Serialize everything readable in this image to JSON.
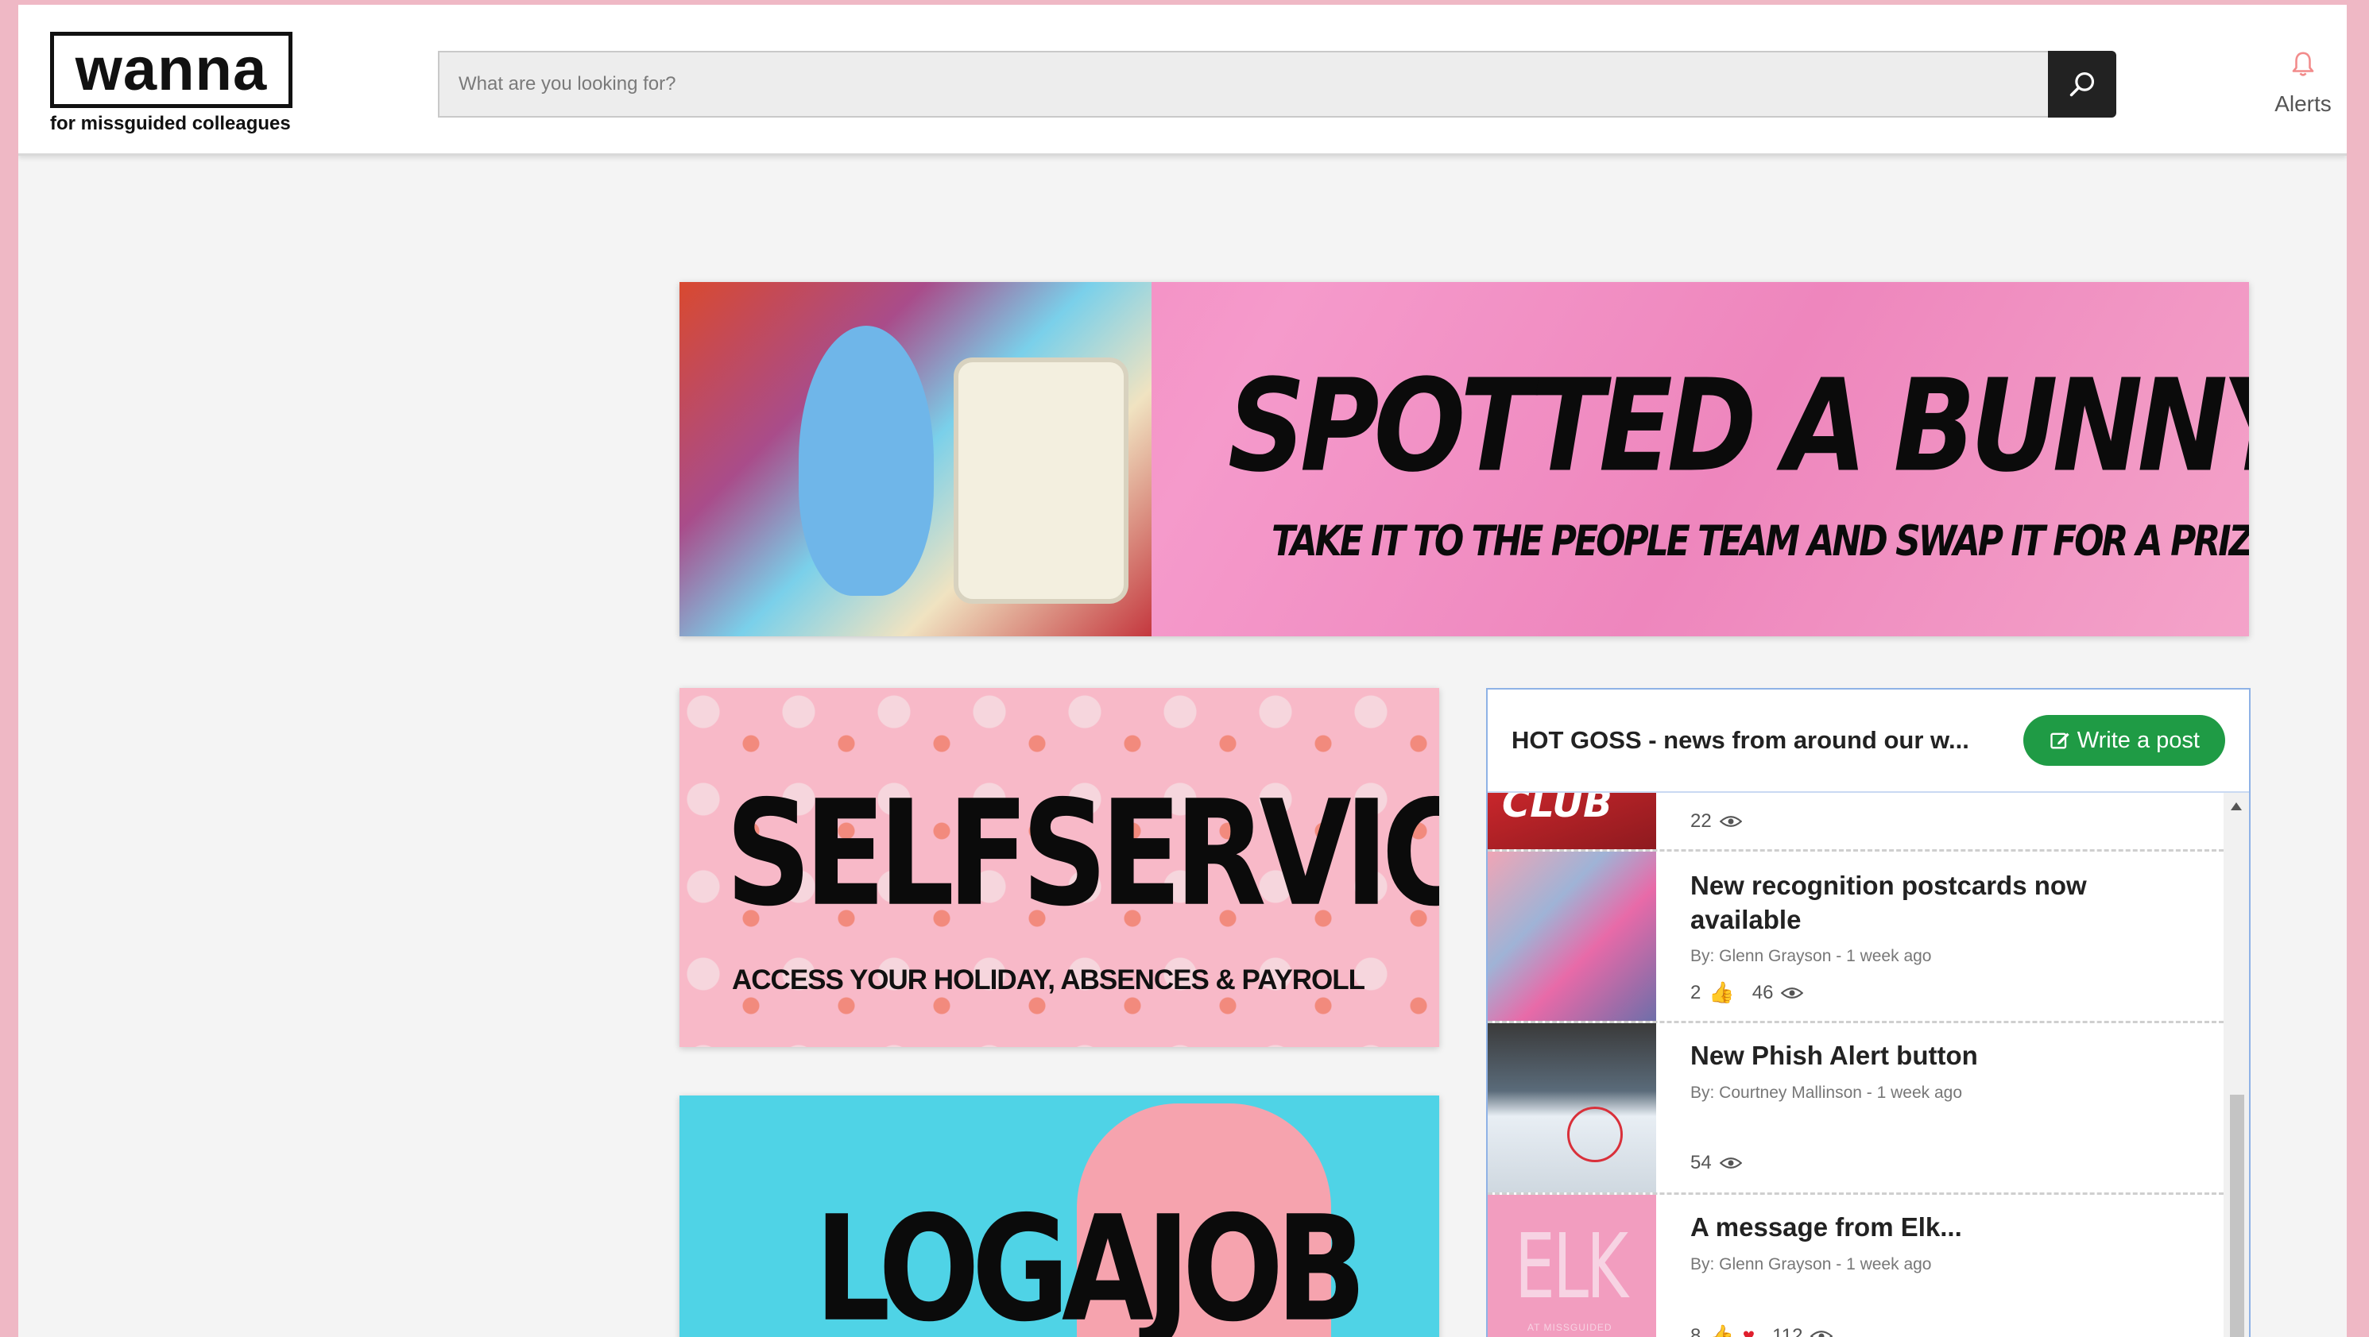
{
  "header": {
    "logo_text": "wanna",
    "logo_tagline": "for missguided colleagues",
    "search_placeholder": "What are you looking for?",
    "alerts_label": "Alerts"
  },
  "banners": {
    "bunny": {
      "title": "SPOTTED A BUNNY?",
      "subtitle": "TAKE IT TO THE PEOPLE TEAM AND SWAP IT FOR A PRIZE"
    },
    "selfservice": {
      "title": "SELFSERVICE",
      "subtitle": "ACCESS YOUR HOLIDAY, ABSENCES & PAYROLL"
    },
    "logajob": {
      "title": "LOGAJOB"
    }
  },
  "feed": {
    "title": "HOT GOSS - news from around our w...",
    "write_label": "Write a post",
    "items": [
      {
        "thumb_text": "CLUB",
        "views": "22"
      },
      {
        "title": "New recognition postcards now available",
        "byline": "By: Glenn Grayson - 1 week ago",
        "likes": "2",
        "views": "46"
      },
      {
        "title": "New Phish Alert button",
        "byline": "By: Courtney Mallinson - 1 week ago",
        "views": "54"
      },
      {
        "thumb_text": "ELK",
        "thumb_subtext": "AT MISSGUIDED",
        "title": "A message from Elk...",
        "byline": "By: Glenn Grayson - 1 week ago",
        "likes": "8",
        "views": "112"
      }
    ]
  },
  "colors": {
    "page_border": "#efb8c5",
    "accent_green": "#1f9b45",
    "search_button": "#222222",
    "feed_border": "#8fb2e6"
  }
}
